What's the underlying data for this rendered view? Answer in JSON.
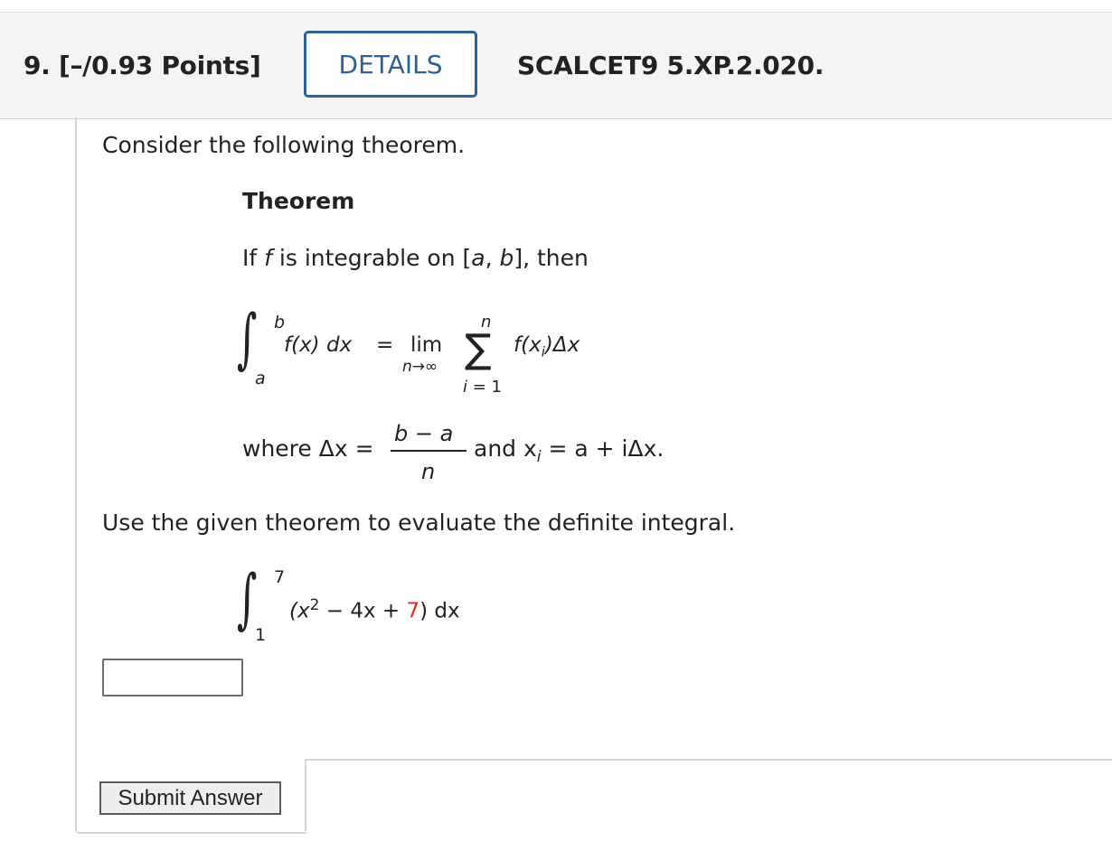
{
  "header": {
    "question_number": "9.",
    "points": "[–/0.93 Points]",
    "details_label": "DETAILS",
    "problem_code": "SCALCET9 5.XP.2.020."
  },
  "problem": {
    "intro": "Consider the following theorem.",
    "theorem_title": "Theorem",
    "theorem_line": {
      "if": "If",
      "f": "f",
      "is_integrable": "is integrable on [",
      "a": "a",
      "comma": ", ",
      "b": "b",
      "then": "], then"
    },
    "formula": {
      "upper": "b",
      "lower": "a",
      "integrand": "f(x) dx",
      "equals": "=",
      "lim": "lim",
      "lim_sub": "n→∞",
      "sum_top": "n",
      "sum_bottom": "i = 1",
      "sum_term": "f(x",
      "sum_sub": "i",
      "sum_tail": ")Δx"
    },
    "where": {
      "where_text": "where Δx =",
      "numerator": "b − a",
      "denominator": "n",
      "and_text": "and x",
      "sub_i": "i",
      "rest": "= a + iΔx."
    },
    "instruction": "Use the given theorem to evaluate the definite integral.",
    "integral": {
      "upper": "7",
      "lower": "1",
      "open": "(x",
      "exp": "2",
      "middle": " − 4x + ",
      "constant": "7",
      "close": ") dx"
    }
  },
  "answer": {
    "value": ""
  },
  "submit_label": "Submit Answer",
  "colors": {
    "accent": "#2f6094",
    "randomized_value": "#e02b20"
  }
}
